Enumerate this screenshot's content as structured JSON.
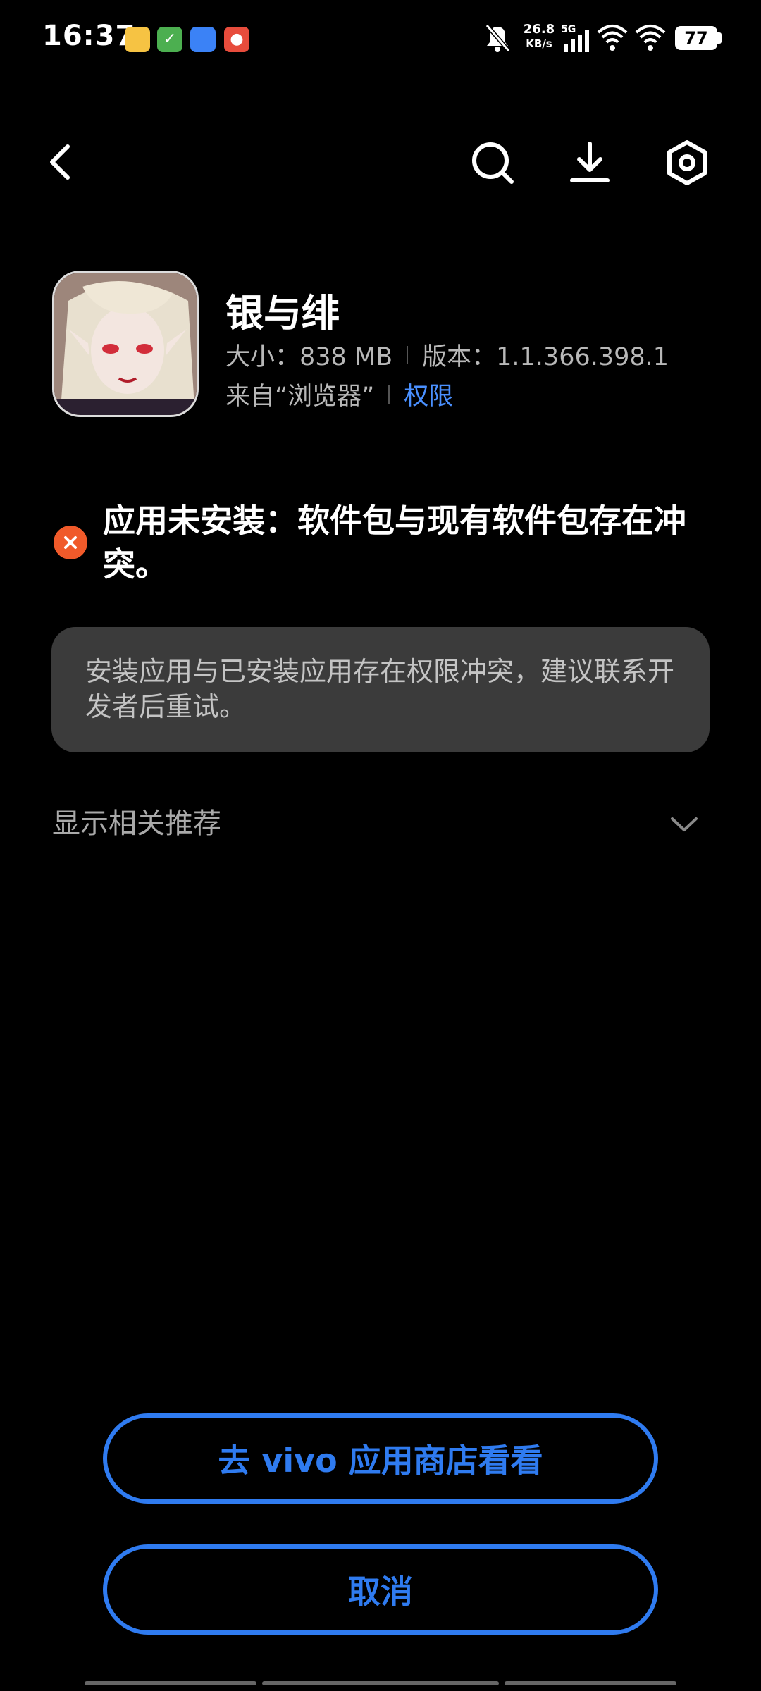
{
  "status_bar": {
    "time": "16:37",
    "net_speed_value": "26.8",
    "net_speed_unit": "KB/s",
    "network": "5G",
    "battery": "77"
  },
  "header": {
    "icons": [
      "back-icon",
      "search-icon",
      "download-icon",
      "settings-icon"
    ]
  },
  "app": {
    "name": "银与绯",
    "size_label": "大小：838 MB",
    "version_label": "版本：1.1.366.398.1",
    "source_label": "来自“浏览器”",
    "permissions_link": "权限"
  },
  "error": {
    "title": "应用未安装：软件包与现有软件包存在冲突。",
    "detail": "安装应用与已安装应用存在权限冲突，建议联系开发者后重试。"
  },
  "recommend": {
    "label": "显示相关推荐"
  },
  "buttons": {
    "store": "去 vivo 应用商店看看",
    "cancel": "取消"
  },
  "colors": {
    "accent": "#2f7bf0",
    "error": "#f05a2a",
    "background": "#000000"
  }
}
